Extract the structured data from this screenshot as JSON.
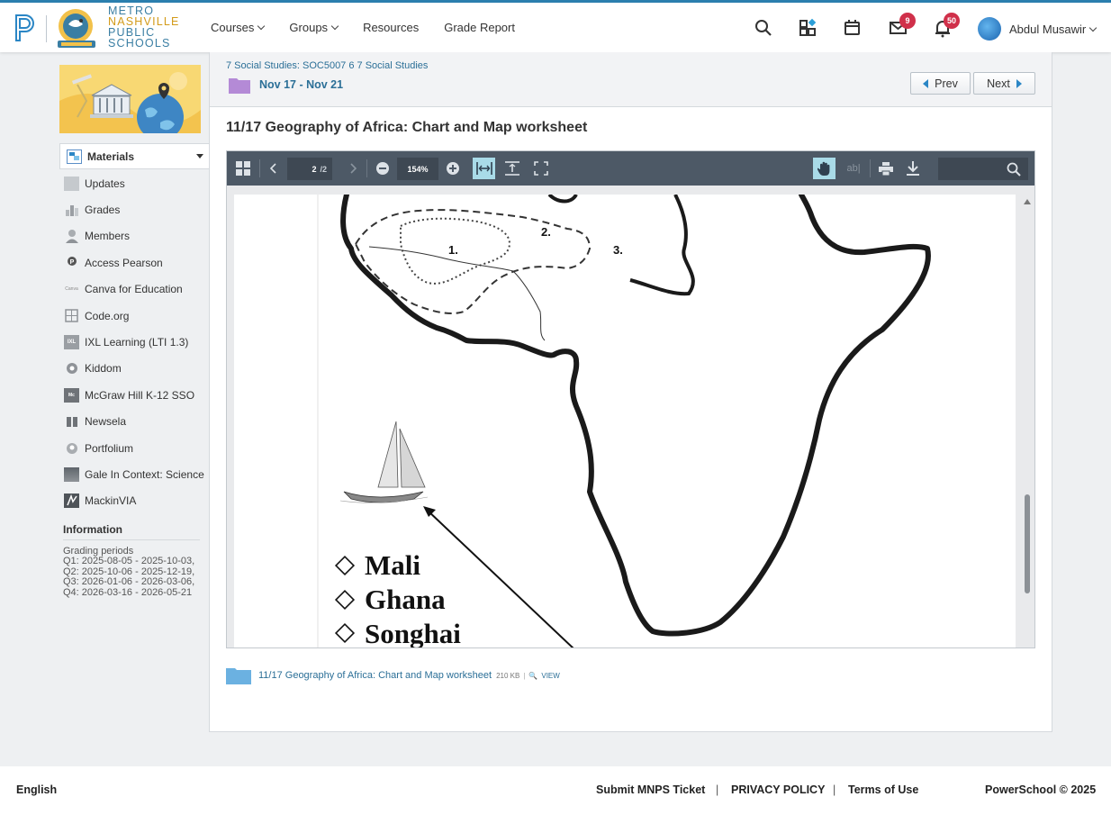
{
  "header": {
    "district": [
      "METRO",
      "NASHVILLE",
      "PUBLIC",
      "SCHOOLS"
    ],
    "nav": [
      "Courses",
      "Groups",
      "Resources",
      "Grade Report"
    ],
    "messages_badge": "9",
    "notifications_badge": "50",
    "user_name": "Abdul Musawir"
  },
  "sidebar": {
    "materials_label": "Materials",
    "items": [
      {
        "label": "Updates",
        "icon": "updates-icon"
      },
      {
        "label": "Grades",
        "icon": "grades-icon"
      },
      {
        "label": "Members",
        "icon": "members-icon"
      },
      {
        "label": "Access Pearson",
        "icon": "pearson-icon"
      },
      {
        "label": "Canva for Education",
        "icon": "canva-icon"
      },
      {
        "label": "Code.org",
        "icon": "code-org-icon"
      },
      {
        "label": "IXL Learning (LTI 1.3)",
        "icon": "ixl-icon"
      },
      {
        "label": "Kiddom",
        "icon": "kiddom-icon"
      },
      {
        "label": "McGraw Hill K-12 SSO",
        "icon": "mcgraw-hill-icon"
      },
      {
        "label": "Newsela",
        "icon": "newsela-icon"
      },
      {
        "label": "Portfolium",
        "icon": "portfolium-icon"
      },
      {
        "label": "Gale In Context: Science",
        "icon": "gale-icon"
      },
      {
        "label": "MackinVIA",
        "icon": "mackinvia-icon"
      }
    ],
    "info_title": "Information",
    "grading_title": "Grading periods",
    "grading_periods": [
      "Q1: 2025-08-05 - 2025-10-03,",
      "Q2: 2025-10-06 - 2025-12-19,",
      "Q3: 2026-01-06 - 2026-03-06,",
      "Q4: 2026-03-16 - 2026-05-21"
    ]
  },
  "main": {
    "breadcrumb": "7 Social Studies: SOC5007 6 7 Social Studies",
    "week": "Nov 17 - Nov 21",
    "prev_label": "Prev",
    "next_label": "Next",
    "title": "11/17 Geography of Africa: Chart and Map worksheet"
  },
  "viewer": {
    "page_number": "2",
    "page_total": "/2",
    "zoom": "154%",
    "map_labels": [
      "1.",
      "2.",
      "3."
    ],
    "options": [
      "Mali",
      "Ghana",
      "Songhai"
    ]
  },
  "attachment": {
    "name": "11/17 Geography of Africa: Chart and Map worksheet",
    "size": "210 KB",
    "view_label": "VIEW"
  },
  "footer": {
    "language": "English",
    "ticket": "Submit MNPS Ticket",
    "privacy": "PRIVACY POLICY",
    "terms": "Terms of Use",
    "copyright": "PowerSchool © 2025"
  },
  "colors": {
    "accent": "#2b6f97",
    "badge": "#d0304a",
    "toolbar": "#4d5966",
    "toolbar_active": "#a9dbe8"
  }
}
